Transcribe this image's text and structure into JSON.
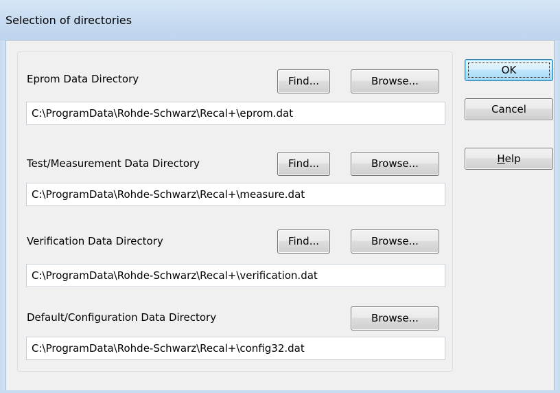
{
  "window": {
    "title": "Selection of directories"
  },
  "directories": [
    {
      "label": "Eprom Data Directory",
      "path": "C:\\ProgramData\\Rohde-Schwarz\\Recal+\\eprom.dat",
      "find_label": "Find...",
      "browse_label": "Browse..."
    },
    {
      "label": "Test/Measurement Data Directory",
      "path": "C:\\ProgramData\\Rohde-Schwarz\\Recal+\\measure.dat",
      "find_label": "Find...",
      "browse_label": "Browse..."
    },
    {
      "label": "Verification Data Directory",
      "path": "C:\\ProgramData\\Rohde-Schwarz\\Recal+\\verification.dat",
      "find_label": "Find...",
      "browse_label": "Browse..."
    },
    {
      "label": "Default/Configuration Data Directory",
      "path": "C:\\ProgramData\\Rohde-Schwarz\\Recal+\\config32.dat",
      "browse_label": "Browse..."
    }
  ],
  "buttons": {
    "ok": "OK",
    "cancel": "Cancel",
    "help_mnemonic": "H",
    "help_rest": "elp"
  },
  "colors": {
    "titlebar": "#c6daf0",
    "dialog_bg": "#f0f0f0",
    "default_button_border": "#3c7fb1"
  }
}
